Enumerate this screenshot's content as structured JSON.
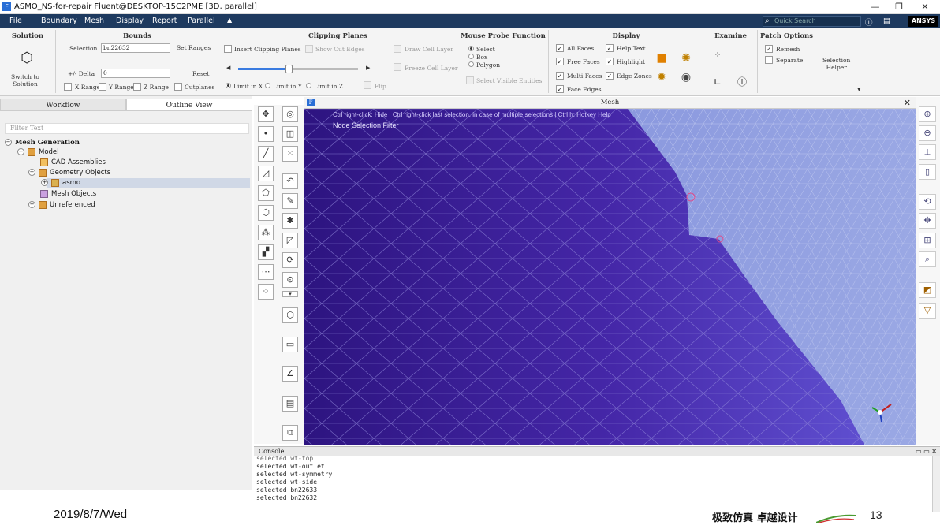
{
  "window": {
    "title": "ASMO_NS-for-repair Fluent@DESKTOP-15C2PME  [3D, parallel]",
    "minimize": "—",
    "restore": "❐",
    "close": "✕"
  },
  "menu": {
    "items": [
      "File",
      "Boundary",
      "Mesh",
      "Display",
      "Report",
      "Parallel",
      "▲"
    ],
    "search_placeholder": "Quick Search",
    "logo": "ANSYS"
  },
  "ribbon": {
    "solution": {
      "header": "Solution",
      "button": "Switch to\nSolution"
    },
    "bounds": {
      "header": "Bounds",
      "selection_label": "Selection",
      "selection_value": "bn22632",
      "set_ranges": "Set Ranges",
      "delta_label": "+/- Delta",
      "delta_value": "0",
      "reset": "Reset",
      "x_range": "X Range",
      "y_range": "Y Range",
      "z_range": "Z Range",
      "cutplanes": "Cutplanes"
    },
    "clipping": {
      "header": "Clipping Planes",
      "insert": "Insert Clipping Planes",
      "show_cut_edges": "Show Cut Edges",
      "draw_cell_layer": "Draw Cell Layer",
      "freeze_cell_layer": "Freeze Cell Layer",
      "limit_x": "Limit in X",
      "limit_y": "Limit in Y",
      "limit_z": "Limit in Z",
      "flip": "Flip",
      "slider_value": 0.42
    },
    "probe": {
      "header": "Mouse Probe Function",
      "select": "Select",
      "box": "Box",
      "polygon": "Polygon",
      "select_visible": "Select Visible Entities"
    },
    "display": {
      "header": "Display",
      "all_faces": "All Faces",
      "free_faces": "Free Faces",
      "multi_faces": "Multi Faces",
      "face_edges": "Face Edges",
      "help_text": "Help Text",
      "highlight": "Highlight",
      "edge_zones": "Edge Zones"
    },
    "examine": {
      "header": "Examine"
    },
    "patch": {
      "header": "Patch Options",
      "remesh": "Remesh",
      "separate": "Separate"
    },
    "selection_helper": "Selection\nHelper"
  },
  "left_panel": {
    "tabs": [
      "Workflow",
      "Outline View"
    ],
    "filter_placeholder": "Filter Text",
    "tree": {
      "root": "Mesh Generation",
      "model": "Model",
      "cad": "CAD Assemblies",
      "geometry": "Geometry Objects",
      "asmo": "asmo",
      "mesh_objects": "Mesh Objects",
      "unreferenced": "Unreferenced"
    }
  },
  "viewport": {
    "title": "Mesh",
    "hint": "Ctrl right-click: Hide | Ctrl right-click last selection, in case of multiple selections | Ctrl h: Hotkey Help",
    "filter": "Node Selection Filter"
  },
  "console": {
    "header": "Console",
    "lines": [
      "selected wt-top",
      "selected wt-outlet",
      "selected wt-symmetry",
      "selected wt-side",
      "selected bn22633",
      "selected bn22632"
    ]
  },
  "footer": {
    "date": "2019/8/7/Wed",
    "slogan": "极致仿真 卓越设计",
    "page": "13"
  },
  "colors": {
    "menubar": "#1e3a5f",
    "mesh_dark": "#3d1d9a",
    "mesh_light": "#8fa0e0"
  }
}
